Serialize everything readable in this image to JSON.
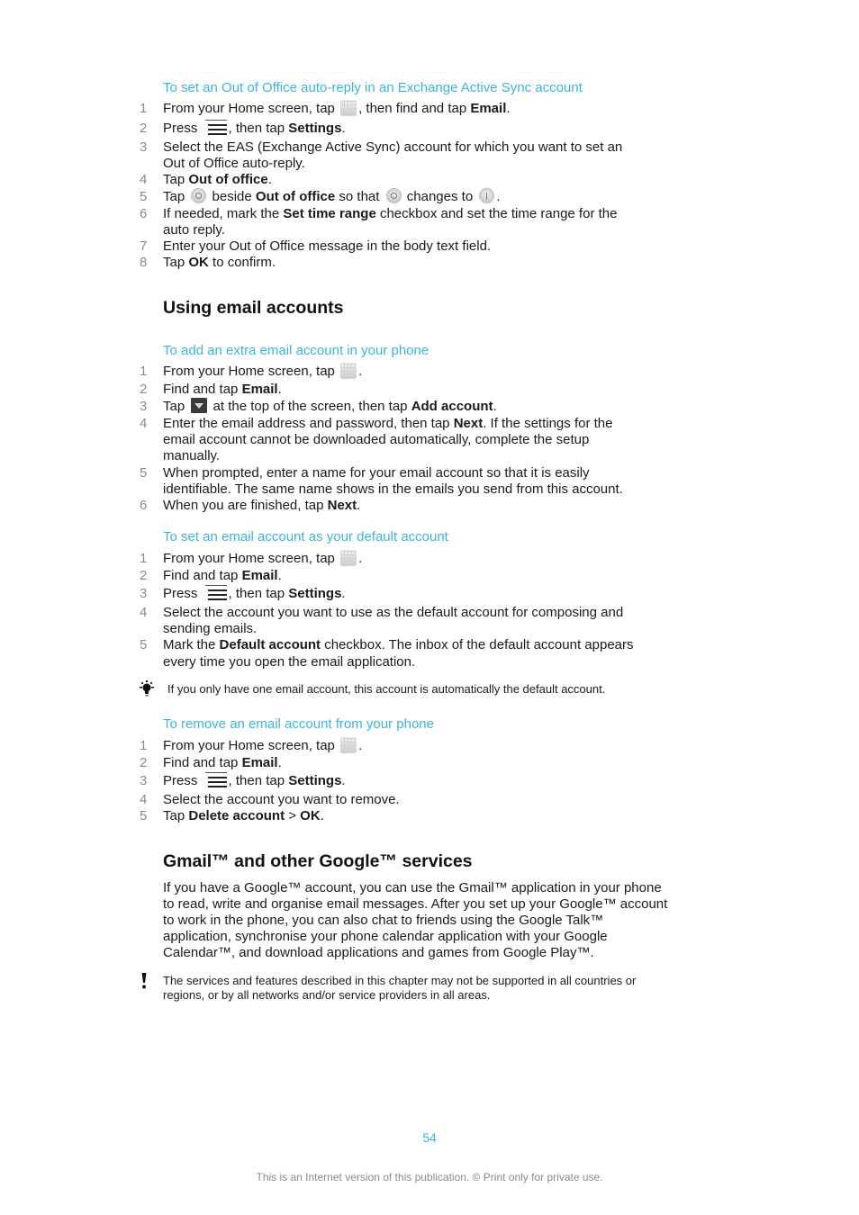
{
  "procedures": [
    {
      "title": "To set an Out of Office auto-reply in an Exchange Active Sync account",
      "steps": [
        {
          "num": "1",
          "a": "From your Home screen, tap ",
          "b": ", then find and tap ",
          "bold": "Email",
          "c": "."
        },
        {
          "num": "2",
          "a": "Press ",
          "b": ", then tap ",
          "bold": "Settings",
          "c": "."
        },
        {
          "num": "3",
          "line1": "Select the EAS (Exchange Active Sync) account for which you want to set an",
          "line2": "Out of Office auto-reply."
        },
        {
          "num": "4",
          "a": "Tap ",
          "bold": "Out of office",
          "c": "."
        },
        {
          "num": "5",
          "a": "Tap ",
          "b": " beside ",
          "bold": "Out of office",
          "c": " so that ",
          "d": " changes to ",
          "e": "."
        },
        {
          "num": "6",
          "a": "If needed, mark the ",
          "bold": "Set time range",
          "c": " checkbox and set the time range for the",
          "line2": "auto reply."
        },
        {
          "num": "7",
          "a": "Enter your Out of Office message in the body text field."
        },
        {
          "num": "8",
          "a": "Tap ",
          "bold": "OK",
          "c": " to confirm."
        }
      ]
    },
    {
      "title": "To add an extra email account in your phone",
      "steps": [
        {
          "num": "1",
          "a": "From your Home screen, tap ",
          "c": "."
        },
        {
          "num": "2",
          "a": "Find and tap ",
          "bold": "Email",
          "c": "."
        },
        {
          "num": "3",
          "a": "Tap ",
          "b": " at the top of the screen, then tap ",
          "bold": "Add account",
          "c": "."
        },
        {
          "num": "4",
          "a": "Enter the email address and password, then tap ",
          "bold": "Next",
          "c": ". If the settings for the",
          "line2": "email account cannot be downloaded automatically, complete the setup",
          "line3": "manually."
        },
        {
          "num": "5",
          "line1": "When prompted, enter a name for your email account so that it is easily",
          "line2": "identifiable. The same name shows in the emails you send from this account."
        },
        {
          "num": "6",
          "a": "When you are finished, tap ",
          "bold": "Next",
          "c": "."
        }
      ]
    },
    {
      "title": "To set an email account as your default account",
      "steps": [
        {
          "num": "1",
          "a": "From your Home screen, tap ",
          "c": "."
        },
        {
          "num": "2",
          "a": "Find and tap ",
          "bold": "Email",
          "c": "."
        },
        {
          "num": "3",
          "a": "Press ",
          "b": ", then tap ",
          "bold": "Settings",
          "c": "."
        },
        {
          "num": "4",
          "line1": "Select the account you want to use as the default account for composing and",
          "line2": "sending emails."
        },
        {
          "num": "5",
          "a": "Mark the ",
          "bold": "Default account",
          "c": " checkbox. The inbox of the default account appears",
          "line2": "every time you open the email application."
        }
      ],
      "tip": "If you only have one email account, this account is automatically the default account."
    },
    {
      "title": "To remove an email account from your phone",
      "steps": [
        {
          "num": "1",
          "a": "From your Home screen, tap ",
          "c": "."
        },
        {
          "num": "2",
          "a": "Find and tap ",
          "bold": "Email",
          "c": "."
        },
        {
          "num": "3",
          "a": "Press ",
          "b": ", then tap ",
          "bold": "Settings",
          "c": "."
        },
        {
          "num": "4",
          "a": "Select the account you want to remove."
        },
        {
          "num": "5",
          "a": "Tap ",
          "bold": "Delete account",
          "c": " > ",
          "bold2": "OK",
          "d": "."
        }
      ]
    }
  ],
  "sections": {
    "using_email": "Using email accounts",
    "gmail": "Gmail™ and other Google™ services"
  },
  "gmail_paragraph": [
    "If you have a Google™ account, you can use the Gmail™ application in your phone",
    "to read, write and organise email messages. After you set up your Google™ account",
    "to work in the phone, you can also chat to friends using the Google Talk™",
    "application, synchronise your phone calendar application with your Google",
    "Calendar™, and download applications and games from Google Play™."
  ],
  "warning": [
    "The services and features described in this chapter may not be supported in all countries or",
    "regions, or by all networks and/or service providers in all areas."
  ],
  "icons": {
    "apps": "apps-grid-icon",
    "menu": "menu-icon",
    "toggle_off": "toggle-off-icon",
    "toggle_on": "toggle-on-icon",
    "dropdown": "dropdown-arrow-icon",
    "tip": "lightbulb-tip-icon",
    "warning": "exclamation-warning-icon"
  },
  "colors": {
    "accent": "#3cb4d9",
    "step_number": "#8a8a8a",
    "text": "#1a1a1a"
  },
  "page_number": "54",
  "footer": "This is an Internet version of this publication. © Print only for private use."
}
